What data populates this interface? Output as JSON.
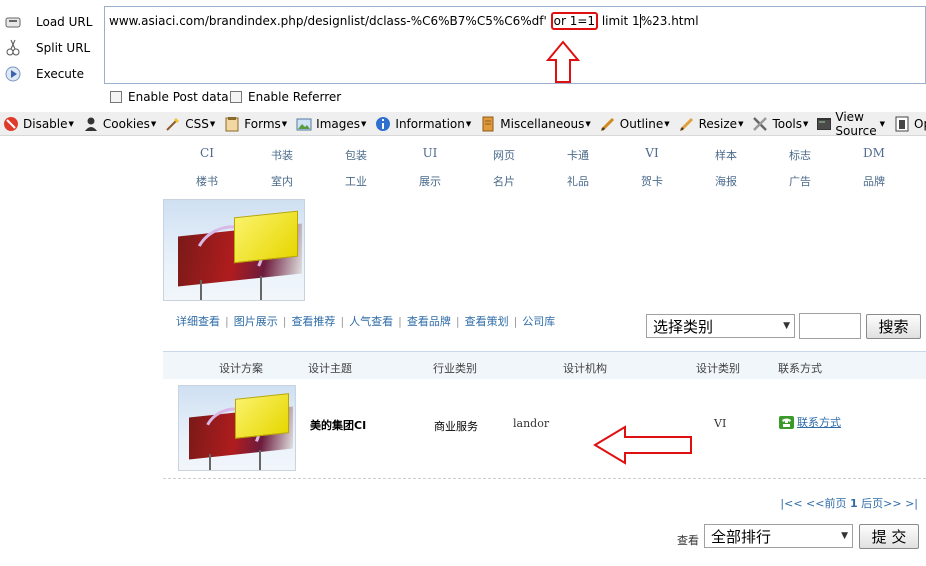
{
  "hackbar": {
    "actions": [
      {
        "label": "Load URL",
        "icon": "load-url-icon"
      },
      {
        "label": "Split URL",
        "icon": "split-url-icon"
      },
      {
        "label": "Execute",
        "icon": "execute-icon"
      }
    ],
    "url": {
      "prefix": "www.asiaci.com/brandindex.php/designlist/dclass-%C6%B7%C5%C6%df' ",
      "highlight": "or 1=1",
      "mid": " limit 1",
      "suffix": "%23.html"
    },
    "checkboxes": [
      {
        "label": "Enable Post data",
        "checked": false
      },
      {
        "label": "Enable Referrer",
        "checked": false
      }
    ]
  },
  "devbar": {
    "items": [
      {
        "label": "Disable",
        "icon": "disable-icon"
      },
      {
        "label": "Cookies",
        "icon": "cookies-icon"
      },
      {
        "label": "CSS",
        "icon": "css-icon"
      },
      {
        "label": "Forms",
        "icon": "forms-icon"
      },
      {
        "label": "Images",
        "icon": "images-icon"
      },
      {
        "label": "Information",
        "icon": "information-icon"
      },
      {
        "label": "Miscellaneous",
        "icon": "miscellaneous-icon"
      },
      {
        "label": "Outline",
        "icon": "outline-icon"
      },
      {
        "label": "Resize",
        "icon": "resize-icon"
      },
      {
        "label": "Tools",
        "icon": "tools-icon"
      },
      {
        "label": "View Source",
        "icon": "view-source-icon"
      },
      {
        "label": "Options",
        "icon": "options-icon"
      }
    ]
  },
  "categories": {
    "row1": [
      "CI",
      "书装",
      "包装",
      "UI",
      "网页",
      "卡通",
      "VI",
      "样本",
      "标志",
      "DM"
    ],
    "row2": [
      "楼书",
      "室内",
      "工业",
      "展示",
      "名片",
      "礼品",
      "贺卡",
      "海报",
      "广告",
      "品牌"
    ]
  },
  "nav_links": [
    "详细查看",
    "图片展示",
    "查看推荐",
    "人气查看",
    "查看品牌",
    "查看策划",
    "公司库"
  ],
  "search": {
    "category_select": "选择类别",
    "query_value": "",
    "button": "搜索"
  },
  "table": {
    "headers": [
      "设计方案",
      "设计主题",
      "行业类别",
      "设计机构",
      "设计类别",
      "联系方式"
    ],
    "rows": [
      {
        "theme": "美的集团CI",
        "industry": "商业服务",
        "agency": "landor",
        "design_type": "VI",
        "contact": "联系方式"
      }
    ]
  },
  "pagination": {
    "first": "|<<",
    "prev": "<<前页",
    "current": "1",
    "next": "后页>>",
    "last": ">|"
  },
  "sort": {
    "label": "查看",
    "select": "全部排行",
    "button": "提 交"
  },
  "colors": {
    "annotation": "#e01010",
    "link": "#2f6ca8"
  }
}
